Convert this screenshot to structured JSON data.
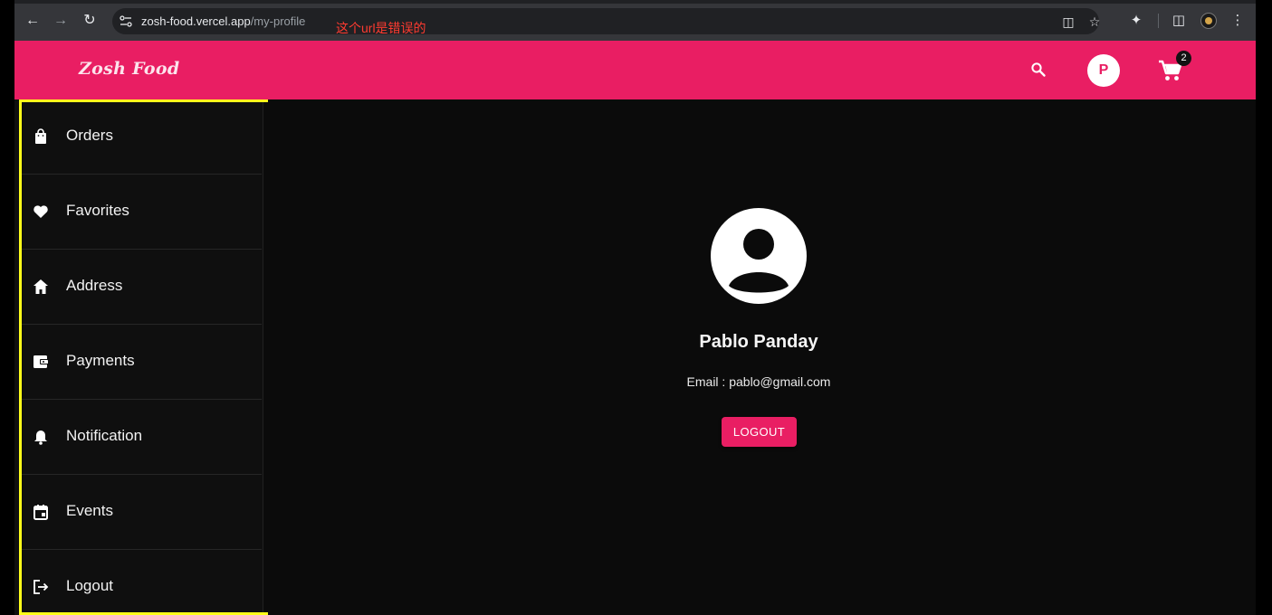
{
  "browser": {
    "url_host": "zosh-food.vercel.app",
    "url_path": "/my-profile",
    "annotation": "这个url是错误的"
  },
  "header": {
    "logo": "Zosh Food",
    "avatar_letter": "P",
    "cart_count": "2",
    "accent_color": "#e91e63"
  },
  "sidebar": {
    "items": [
      {
        "label": "Orders",
        "icon": "shopping-bag-icon"
      },
      {
        "label": "Favorites",
        "icon": "heart-icon"
      },
      {
        "label": "Address",
        "icon": "home-icon"
      },
      {
        "label": "Payments",
        "icon": "wallet-icon"
      },
      {
        "label": "Notification",
        "icon": "bell-icon"
      },
      {
        "label": "Events",
        "icon": "calendar-icon"
      },
      {
        "label": "Logout",
        "icon": "logout-icon"
      }
    ]
  },
  "profile": {
    "name": "Pablo Panday",
    "email": "Email : pablo@gmail.com",
    "logout_label": "LOGOUT"
  }
}
